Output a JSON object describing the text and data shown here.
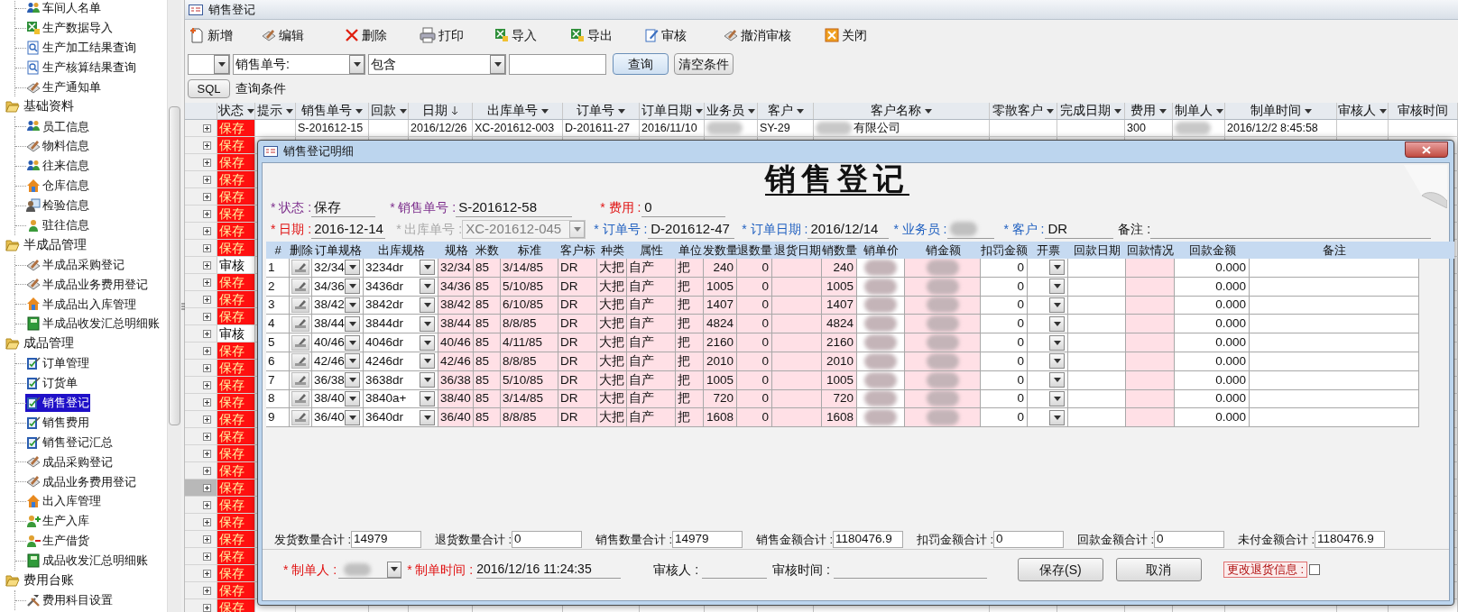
{
  "sidebar": {
    "tree": [
      {
        "label": "车间人名单",
        "kind": "people",
        "selected": false
      },
      {
        "label": "生产数据导入",
        "kind": "excel",
        "selected": false
      },
      {
        "label": "生产加工结果查询",
        "kind": "magdoc",
        "selected": false
      },
      {
        "label": "生产核算结果查询",
        "kind": "magdoc",
        "selected": false
      },
      {
        "label": "生产通知单",
        "kind": "pencildoc",
        "selected": false
      },
      {
        "label": "基础资料",
        "kind": "folder",
        "expanded": true,
        "children": [
          {
            "label": "员工信息",
            "kind": "people",
            "selected": false
          },
          {
            "label": "物料信息",
            "kind": "pencildoc",
            "selected": false
          },
          {
            "label": "往来信息",
            "kind": "people",
            "selected": false
          },
          {
            "label": "仓库信息",
            "kind": "house",
            "selected": false
          },
          {
            "label": "检验信息",
            "kind": "idcard",
            "selected": false
          },
          {
            "label": "驻往信息",
            "kind": "person",
            "selected": false
          }
        ]
      },
      {
        "label": "半成品管理",
        "kind": "folder",
        "expanded": true,
        "children": [
          {
            "label": "半成品采购登记",
            "kind": "pencildoc",
            "selected": false
          },
          {
            "label": "半成品业务费用登记",
            "kind": "pencildoc",
            "selected": false
          },
          {
            "label": "半成品出入库管理",
            "kind": "house",
            "selected": false
          },
          {
            "label": "半成品收发汇总明细账",
            "kind": "ledger",
            "selected": false
          }
        ]
      },
      {
        "label": "成品管理",
        "kind": "folder",
        "expanded": true,
        "children": [
          {
            "label": "订单管理",
            "kind": "checkdoc",
            "selected": false
          },
          {
            "label": "订货单",
            "kind": "checkdoc",
            "selected": false
          },
          {
            "label": "销售登记",
            "kind": "checkdoc",
            "selected": true
          },
          {
            "label": "销售费用",
            "kind": "checkdoc",
            "selected": false
          },
          {
            "label": "销售登记汇总",
            "kind": "checkdoc",
            "selected": false
          },
          {
            "label": "成品采购登记",
            "kind": "pencildoc",
            "selected": false
          },
          {
            "label": "成品业务费用登记",
            "kind": "pencildoc",
            "selected": false
          },
          {
            "label": "出入库管理",
            "kind": "house",
            "selected": false
          },
          {
            "label": "生产入库",
            "kind": "personplus",
            "selected": false
          },
          {
            "label": "生产借货",
            "kind": "personminus",
            "selected": false
          },
          {
            "label": "成品收发汇总明细账",
            "kind": "ledger",
            "selected": false
          }
        ]
      },
      {
        "label": "费用台账",
        "kind": "folder",
        "expanded": true,
        "children": [
          {
            "label": "费用科目设置",
            "kind": "tools",
            "selected": false
          }
        ]
      }
    ]
  },
  "window": {
    "title": "销售登记"
  },
  "toolbar": [
    {
      "label": "新增",
      "kind": "newdoc"
    },
    {
      "label": "编辑",
      "kind": "pencildoc"
    },
    {
      "label": "删除",
      "kind": "cross"
    },
    {
      "label": "打印",
      "kind": "printer"
    },
    {
      "label": "导入",
      "kind": "excel"
    },
    {
      "label": "导出",
      "kind": "excel"
    },
    {
      "label": "审核",
      "kind": "editdoc"
    },
    {
      "label": "撤消审核",
      "kind": "pencildoc"
    },
    {
      "label": "关闭",
      "kind": "close"
    }
  ],
  "filter": {
    "field": "销售单号:",
    "operator": "包含",
    "search_button": "查询",
    "clear_button": "清空条件",
    "sql_button": "SQL",
    "condition_label": "查询条件"
  },
  "grid": {
    "columns": [
      {
        "label": "状态",
        "sorted": false
      },
      {
        "label": "提示",
        "sorted": false
      },
      {
        "label": "销售单号",
        "sorted": false
      },
      {
        "label": "回款",
        "sorted": false
      },
      {
        "label": "日期",
        "sorted": true
      },
      {
        "label": "出库单号",
        "sorted": false
      },
      {
        "label": "订单号",
        "sorted": false
      },
      {
        "label": "订单日期",
        "sorted": false
      },
      {
        "label": "业务员",
        "sorted": false
      },
      {
        "label": "客户",
        "sorted": false
      },
      {
        "label": "客户名称",
        "sorted": false
      },
      {
        "label": "零散客户",
        "sorted": false
      },
      {
        "label": "完成日期",
        "sorted": false
      },
      {
        "label": "费用",
        "sorted": false
      },
      {
        "label": "制单人",
        "sorted": false
      },
      {
        "label": "制单时间",
        "sorted": false
      },
      {
        "label": "审核人",
        "sorted": false
      },
      {
        "label": "审核时间",
        "sorted": false
      }
    ],
    "rows": [
      {
        "status": "保存",
        "kind": "saved",
        "selected": false,
        "cells": [
          null,
          null,
          "S-201612-15",
          null,
          "2016/12/26",
          "XC-201612-003",
          "D-201611-27",
          "2016/11/10",
          {
            "kind": "blurred"
          },
          "SY-29",
          {
            "kind": "partly_blurred",
            "text": "有限公司"
          },
          null,
          null,
          "300",
          {
            "kind": "blurred"
          },
          "2016/12/2 8:45:58",
          null,
          null
        ]
      },
      {
        "status": "保存",
        "kind": "saved",
        "selected": false
      },
      {
        "status": "保存",
        "kind": "saved",
        "selected": false
      },
      {
        "status": "保存",
        "kind": "saved",
        "selected": false
      },
      {
        "status": "保存",
        "kind": "saved",
        "selected": false
      },
      {
        "status": "保存",
        "kind": "saved",
        "selected": false
      },
      {
        "status": "保存",
        "kind": "saved",
        "selected": false
      },
      {
        "status": "保存",
        "kind": "saved",
        "selected": false
      },
      {
        "status": "审核",
        "kind": "audited",
        "selected": false
      },
      {
        "status": "保存",
        "kind": "saved",
        "selected": false
      },
      {
        "status": "保存",
        "kind": "saved",
        "selected": false
      },
      {
        "status": "保存",
        "kind": "saved",
        "selected": false
      },
      {
        "status": "审核",
        "kind": "audited",
        "selected": false
      },
      {
        "status": "保存",
        "kind": "saved",
        "selected": false
      },
      {
        "status": "保存",
        "kind": "saved",
        "selected": false
      },
      {
        "status": "保存",
        "kind": "saved",
        "selected": false
      },
      {
        "status": "保存",
        "kind": "saved",
        "selected": false
      },
      {
        "status": "保存",
        "kind": "saved",
        "selected": false
      },
      {
        "status": "保存",
        "kind": "saved",
        "selected": false
      },
      {
        "status": "保存",
        "kind": "saved",
        "selected": false
      },
      {
        "status": "保存",
        "kind": "saved",
        "selected": false
      },
      {
        "status": "保存",
        "kind": "saved",
        "selected": true
      },
      {
        "status": "保存",
        "kind": "saved",
        "selected": false
      },
      {
        "status": "保存",
        "kind": "saved",
        "selected": false
      },
      {
        "status": "保存",
        "kind": "saved",
        "selected": false
      },
      {
        "status": "保存",
        "kind": "saved",
        "selected": false
      },
      {
        "status": "保存",
        "kind": "saved",
        "selected": false
      },
      {
        "status": "保存",
        "kind": "saved",
        "selected": false
      },
      {
        "status": "保存",
        "kind": "saved",
        "selected": false
      }
    ]
  },
  "dialog": {
    "title": "销售登记明细",
    "heading": "销售登记",
    "header_rows": [
      {
        "fields": [
          {
            "label": "* 状态 :",
            "value": "保存",
            "color": "#7a2a8a",
            "kind": "text",
            "disabled": false
          },
          {
            "label": "* 销售单号 :",
            "value": "S-201612-58",
            "color": "#7a2a8a",
            "kind": "text",
            "disabled": false
          },
          {
            "label": "* 费用 :",
            "value": "0",
            "color": "#e01010",
            "kind": "text",
            "disabled": false
          }
        ]
      },
      {
        "fields": [
          {
            "label": "* 日期 :",
            "value": "2016-12-14",
            "color": "#e01010",
            "kind": "text",
            "disabled": false
          },
          {
            "label": "* 出库单号 :",
            "value": "XC-201612-045",
            "color": "#a8a8a8",
            "kind": "combo",
            "disabled": true
          },
          {
            "label": "* 订单号 :",
            "value": "D-201612-47",
            "color": "#2060c0",
            "kind": "text",
            "disabled": false
          },
          {
            "label": "* 订单日期 :",
            "value": "2016/12/14",
            "color": "#2060c0",
            "kind": "text",
            "disabled": false
          },
          {
            "label": "* 业务员 :",
            "color": "#2060c0",
            "kind": "redacted",
            "disabled": false
          },
          {
            "label": "* 客户 :",
            "value": "DR",
            "color": "#2060c0",
            "kind": "text",
            "disabled": false
          },
          {
            "label": "备注 :",
            "color": "#111111",
            "kind": "text",
            "disabled": false
          }
        ]
      }
    ],
    "columns": [
      {
        "label": "#",
        "kind": "text",
        "readonly": false
      },
      {
        "label": "删除",
        "kind": "delete",
        "readonly": false
      },
      {
        "label": "订单规格",
        "kind": "combo",
        "readonly": false
      },
      {
        "label": "出库规格",
        "kind": "combo",
        "readonly": false
      },
      {
        "label": "规格",
        "kind": "text",
        "readonly": true
      },
      {
        "label": "米数",
        "kind": "text",
        "readonly": true
      },
      {
        "label": "标准",
        "kind": "text",
        "readonly": true
      },
      {
        "label": "客户标",
        "kind": "text",
        "readonly": true
      },
      {
        "label": "种类",
        "kind": "text",
        "readonly": true
      },
      {
        "label": "属性",
        "kind": "text",
        "readonly": true
      },
      {
        "label": "单位",
        "kind": "text",
        "readonly": true
      },
      {
        "label": "发数量",
        "kind": "number",
        "readonly": true
      },
      {
        "label": "退数量",
        "kind": "number",
        "readonly": true
      },
      {
        "label": "退货日期",
        "kind": "text",
        "readonly": true
      },
      {
        "label": "销数量",
        "kind": "number",
        "readonly": true
      },
      {
        "label": "销单价",
        "kind": "redacted",
        "readonly": false
      },
      {
        "label": "销金额",
        "kind": "redacted",
        "readonly": true
      },
      {
        "label": "扣罚金额",
        "kind": "number",
        "readonly": false
      },
      {
        "label": "开票",
        "kind": "combo",
        "readonly": false
      },
      {
        "label": "回款日期",
        "kind": "text",
        "readonly": false
      },
      {
        "label": "回款情况",
        "kind": "text",
        "readonly": true
      },
      {
        "label": "回款金额",
        "kind": "number",
        "readonly": false
      },
      {
        "label": "备注",
        "kind": "text",
        "readonly": false
      }
    ],
    "rows": [
      {
        "cells": [
          "1",
          null,
          "32/34",
          "3234dr",
          "32/34",
          "85",
          "3/14/85",
          "DR",
          "大把",
          "自产",
          "把",
          "240",
          "0",
          null,
          "240",
          null,
          null,
          "0",
          null,
          null,
          null,
          "0.000",
          null
        ]
      },
      {
        "cells": [
          "2",
          null,
          "34/36",
          "3436dr",
          "34/36",
          "85",
          "5/10/85",
          "DR",
          "大把",
          "自产",
          "把",
          "1005",
          "0",
          null,
          "1005",
          null,
          null,
          "0",
          null,
          null,
          null,
          "0.000",
          null
        ]
      },
      {
        "cells": [
          "3",
          null,
          "38/42",
          "3842dr",
          "38/42",
          "85",
          "6/10/85",
          "DR",
          "大把",
          "自产",
          "把",
          "1407",
          "0",
          null,
          "1407",
          null,
          null,
          "0",
          null,
          null,
          null,
          "0.000",
          null
        ]
      },
      {
        "cells": [
          "4",
          null,
          "38/44",
          "3844dr",
          "38/44",
          "85",
          "8/8/85",
          "DR",
          "大把",
          "自产",
          "把",
          "4824",
          "0",
          null,
          "4824",
          null,
          null,
          "0",
          null,
          null,
          null,
          "0.000",
          null
        ]
      },
      {
        "cells": [
          "5",
          null,
          "40/46",
          "4046dr",
          "40/46",
          "85",
          "4/11/85",
          "DR",
          "大把",
          "自产",
          "把",
          "2160",
          "0",
          null,
          "2160",
          null,
          null,
          "0",
          null,
          null,
          null,
          "0.000",
          null
        ]
      },
      {
        "cells": [
          "6",
          null,
          "42/46",
          "4246dr",
          "42/46",
          "85",
          "8/8/85",
          "DR",
          "大把",
          "自产",
          "把",
          "2010",
          "0",
          null,
          "2010",
          null,
          null,
          "0",
          null,
          null,
          null,
          "0.000",
          null
        ]
      },
      {
        "cells": [
          "7",
          null,
          "36/38",
          "3638dr",
          "36/38",
          "85",
          "5/10/85",
          "DR",
          "大把",
          "自产",
          "把",
          "1005",
          "0",
          null,
          "1005",
          null,
          null,
          "0",
          null,
          null,
          null,
          "0.000",
          null
        ]
      },
      {
        "cells": [
          "8",
          null,
          "38/40",
          "3840a+",
          "38/40",
          "85",
          "3/14/85",
          "DR",
          "大把",
          "自产",
          "把",
          "720",
          "0",
          null,
          "720",
          null,
          null,
          "0",
          null,
          null,
          null,
          "0.000",
          null
        ]
      },
      {
        "cells": [
          "9",
          null,
          "36/40",
          "3640dr",
          "36/40",
          "85",
          "8/8/85",
          "DR",
          "大把",
          "自产",
          "把",
          "1608",
          "0",
          null,
          "1608",
          null,
          null,
          "0",
          null,
          null,
          null,
          "0.000",
          null
        ]
      }
    ],
    "totals": [
      {
        "label": "发货数量合计 :",
        "value": "14979"
      },
      {
        "label": "退货数量合计 :",
        "value": "0"
      },
      {
        "label": "销售数量合计 :",
        "value": "14979"
      },
      {
        "label": "销售金额合计 :",
        "value": "1180476.9"
      },
      {
        "label": "扣罚金额合计 :",
        "value": "0"
      },
      {
        "label": "回款金额合计 :",
        "value": "0"
      },
      {
        "label": "未付金额合计 :",
        "value": "1180476.9"
      }
    ],
    "footer": [
      {
        "label": "* 制单人 :",
        "kind": "redacted-combo",
        "color": "#e01010"
      },
      {
        "label": "* 制单时间 :",
        "value": "2016/12/16 11:24:35",
        "kind": "text",
        "color": "#e01010"
      },
      {
        "label": "审核人 :",
        "kind": "text",
        "color": "#111111"
      },
      {
        "label": "审核时间 :",
        "kind": "text",
        "color": "#111111"
      }
    ],
    "buttons": [
      "保存(S)",
      "取消"
    ],
    "change_returns": {
      "label": "更改退货信息 :",
      "checked": false
    }
  }
}
